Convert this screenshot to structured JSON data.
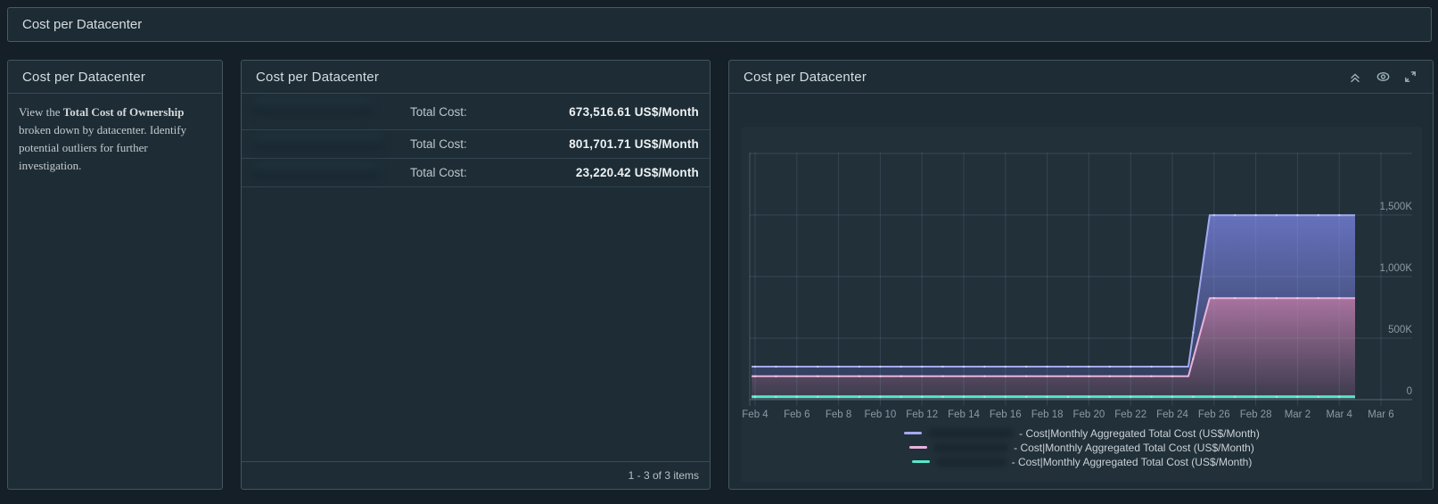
{
  "top_bar": {
    "title": "Cost per Datacenter"
  },
  "left_panel": {
    "title": "Cost per Datacenter",
    "description_prefix": "View the ",
    "description_bold": "Total Cost of Ownership",
    "description_suffix": " broken down by datacenter. Identify potential outliers for further investigation."
  },
  "list_panel": {
    "title": "Cost per Datacenter",
    "rows": [
      {
        "name_redacted": true,
        "label": "Total Cost:",
        "value": "673,516.61 US$/Month"
      },
      {
        "name_redacted": true,
        "label": "Total Cost:",
        "value": "801,701.71 US$/Month"
      },
      {
        "name_redacted": true,
        "label": "Total Cost:",
        "value": "23,220.42 US$/Month"
      }
    ],
    "pagination": "1 - 3 of 3 items"
  },
  "chart_panel": {
    "title": "Cost per Datacenter",
    "header_icons": [
      "collapse-icon",
      "eye-icon",
      "expand-icon"
    ]
  },
  "chart_data": {
    "type": "area",
    "stacked": true,
    "title": "Cost per Datacenter",
    "x_ticks": [
      "Feb 4",
      "Feb 6",
      "Feb 8",
      "Feb 10",
      "Feb 12",
      "Feb 14",
      "Feb 16",
      "Feb 18",
      "Feb 20",
      "Feb 22",
      "Feb 24",
      "Feb 26",
      "Feb 28",
      "Mar 2",
      "Mar 4",
      "Mar 6"
    ],
    "y_ticks": [
      {
        "v": 0,
        "label": "0"
      },
      {
        "v": 500,
        "label": "500K"
      },
      {
        "v": 1000,
        "label": "1,000K"
      },
      {
        "v": 1500,
        "label": "1,500K"
      }
    ],
    "y_gridlines_k": [
      0,
      500,
      1000,
      1500,
      2000
    ],
    "ylim_k": [
      0,
      2000
    ],
    "y_unit": "US$/Month (thousands)",
    "legend_position": "bottom-center",
    "series": [
      {
        "name_redacted": true,
        "legend_label": "- Cost|Monthly Aggregated Total Cost (US$/Month)",
        "color": "#a3aaec",
        "fill_top": "#6671bd",
        "fill_bottom": "#2c3850",
        "area_base": "next",
        "line_width": 2,
        "points_day_kusd": [
          [
            -0.17,
            268
          ],
          [
            20.77,
            268
          ],
          [
            21.79,
            1498.4
          ],
          [
            28.76,
            1498.4
          ]
        ],
        "note": "stacked cumulative top; jumps ~Feb 25 from ~268K to ~1,498K"
      },
      {
        "name_redacted": true,
        "legend_label": "- Cost|Monthly Aggregated Total Cost (US$/Month)",
        "color": "#e9b2dd",
        "fill_top": "#a8739f",
        "fill_bottom": "#3a3a4c",
        "area_base": "zero",
        "line_width": 2,
        "points_day_kusd": [
          [
            -0.17,
            190
          ],
          [
            20.77,
            190
          ],
          [
            21.79,
            824.9
          ],
          [
            28.76,
            824.9
          ]
        ],
        "note": "stacked cumulative top; jumps ~Feb 25 from ~190K to ~825K"
      },
      {
        "name_redacted": true,
        "legend_label": "- Cost|Monthly Aggregated Total Cost (US$/Month)",
        "color": "#58e6c9",
        "fill_top": "#58e6c9",
        "fill_bottom": "#58e6c9",
        "area_base": "none",
        "line_width": 3,
        "points_day_kusd": [
          [
            -0.17,
            23
          ],
          [
            28.76,
            23
          ]
        ],
        "note": "flat near zero (~23K US$/Month)"
      }
    ]
  }
}
